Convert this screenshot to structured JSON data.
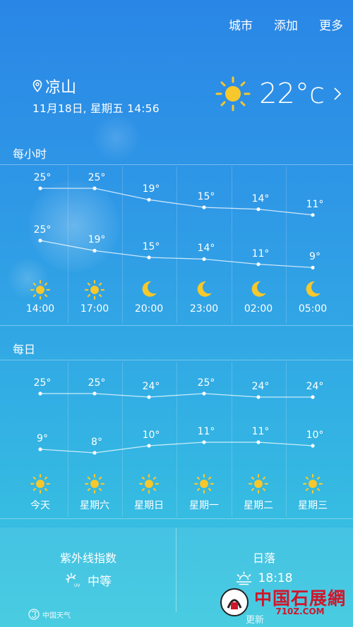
{
  "top_nav": {
    "city": "城市",
    "add": "添加",
    "more": "更多"
  },
  "location": {
    "name": "凉山",
    "datetime": "11月18日, 星期五 14:56"
  },
  "current": {
    "temp": "22°c",
    "icon": "sun-icon"
  },
  "hourly": {
    "label": "每小时",
    "high": [
      "25°",
      "25°",
      "19°",
      "15°",
      "14°",
      "11°"
    ],
    "low": [
      "25°",
      "19°",
      "15°",
      "14°",
      "11°",
      "9°"
    ],
    "high_values": [
      25,
      25,
      19,
      15,
      14,
      11
    ],
    "low_values": [
      25,
      19,
      15,
      14,
      11,
      9
    ],
    "icons": [
      "sun-icon",
      "sun-icon",
      "moon-icon",
      "moon-icon",
      "moon-icon",
      "moon-icon"
    ],
    "times": [
      "14:00",
      "17:00",
      "20:00",
      "23:00",
      "02:00",
      "05:00"
    ]
  },
  "daily": {
    "label": "每日",
    "high": [
      "25°",
      "25°",
      "24°",
      "25°",
      "24°",
      "24°"
    ],
    "low": [
      "9°",
      "8°",
      "10°",
      "11°",
      "11°",
      "10°"
    ],
    "high_values": [
      25,
      25,
      24,
      25,
      24,
      24
    ],
    "low_values": [
      9,
      8,
      10,
      11,
      11,
      10
    ],
    "icons": [
      "sun-icon",
      "sun-icon",
      "sun-icon",
      "sun-icon",
      "sun-icon",
      "sun-icon"
    ],
    "days": [
      "今天",
      "星期六",
      "星期日",
      "星期一",
      "星期二",
      "星期三"
    ]
  },
  "uv": {
    "title": "紫外线指数",
    "value": "中等",
    "icon": "uv-icon"
  },
  "sunset": {
    "title": "日落",
    "value": "18:18",
    "icon": "sunset-icon"
  },
  "footer": {
    "logo": "中国天气",
    "update": "更新"
  },
  "watermark": {
    "title": "中国石展網",
    "url": "710Z.COM"
  }
}
